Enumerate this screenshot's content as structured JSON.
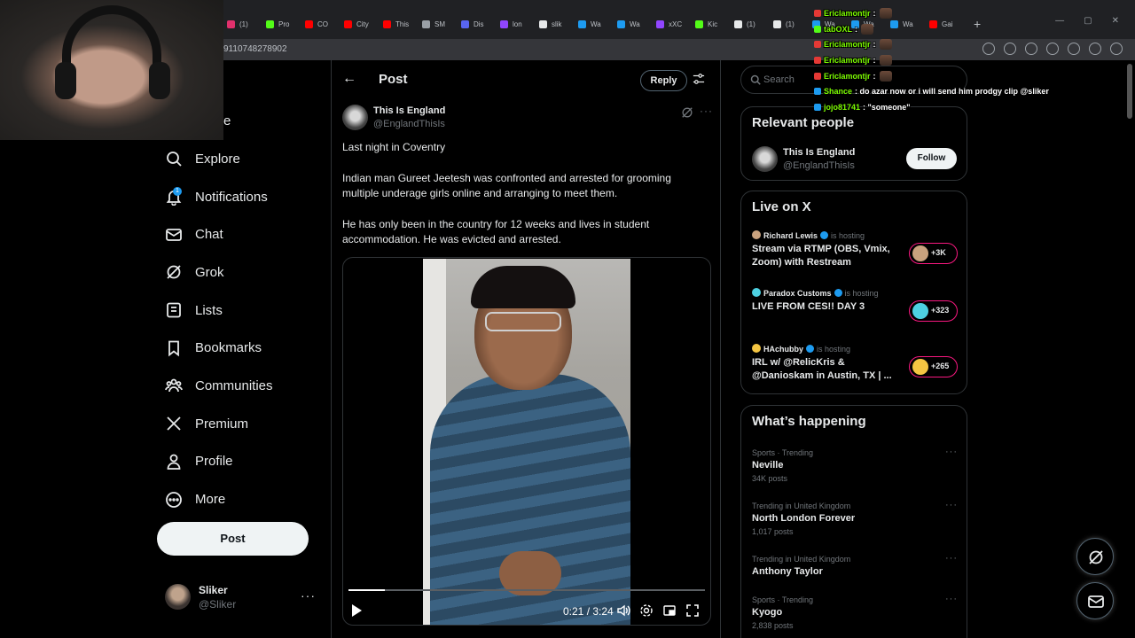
{
  "browser": {
    "tabs": [
      {
        "label": "(1)",
        "color": "#e1306c"
      },
      {
        "label": "Pro",
        "color": "#53fc18"
      },
      {
        "label": "CO",
        "color": "#ff0000"
      },
      {
        "label": "City",
        "color": "#ff0000"
      },
      {
        "label": "This",
        "color": "#ff0000"
      },
      {
        "label": "SM",
        "color": "#9aa0a6"
      },
      {
        "label": "Dis",
        "color": "#5865f2"
      },
      {
        "label": "lon",
        "color": "#9146ff"
      },
      {
        "label": "slik",
        "color": "#e7e9ea"
      },
      {
        "label": "Wa",
        "color": "#1d9bf0"
      },
      {
        "label": "Wa",
        "color": "#1d9bf0"
      },
      {
        "label": "xXC",
        "color": "#9146ff"
      },
      {
        "label": "Kic",
        "color": "#53fc18"
      },
      {
        "label": "(1)",
        "color": "#e7e9ea"
      },
      {
        "label": "(1)",
        "color": "#e7e9ea"
      },
      {
        "label": "Wa",
        "color": "#1d9bf0"
      },
      {
        "label": "Wa",
        "color": "#1d9bf0"
      },
      {
        "label": "Wa",
        "color": "#1d9bf0"
      },
      {
        "label": "Gai",
        "color": "#ff0000"
      }
    ],
    "new_tab": "+",
    "url_partial": "9110748278902"
  },
  "nav": {
    "partial_home": "e",
    "items": [
      {
        "label": "Explore",
        "icon": "search-icon"
      },
      {
        "label": "Notifications",
        "icon": "bell-icon",
        "badge": "1"
      },
      {
        "label": "Chat",
        "icon": "mail-icon"
      },
      {
        "label": "Grok",
        "icon": "grok-icon"
      },
      {
        "label": "Lists",
        "icon": "list-icon"
      },
      {
        "label": "Bookmarks",
        "icon": "bookmark-icon"
      },
      {
        "label": "Communities",
        "icon": "communities-icon"
      },
      {
        "label": "Premium",
        "icon": "x-logo-icon"
      },
      {
        "label": "Profile",
        "icon": "person-icon"
      },
      {
        "label": "More",
        "icon": "more-circle-icon"
      }
    ],
    "post_button": "Post",
    "account": {
      "name": "Sliker",
      "handle": "@Sliker"
    }
  },
  "main": {
    "header_title": "Post",
    "reply_button": "Reply",
    "author": {
      "name": "This Is England",
      "handle": "@EnglandThisIs"
    },
    "paragraphs": [
      "Last night in Coventry",
      "Indian man Gureet Jeetesh was confronted and arrested for grooming multiple underage girls online and arranging to meet them.",
      "He has only been in the country for 12 weeks and lives in student accommodation. He was evicted and arrested."
    ],
    "video": {
      "time": "0:21 / 3:24",
      "progress": 0.103
    }
  },
  "right": {
    "search_placeholder": "Search",
    "relevant": {
      "title": "Relevant people",
      "name": "This Is England",
      "handle": "@EnglandThisIs",
      "follow": "Follow"
    },
    "live": {
      "title": "Live on X",
      "items": [
        {
          "host": "Richard Lewis",
          "suffix": "is hosting",
          "title": "Stream via RTMP (OBS, Vmix, Zoom) with Restream",
          "count": "+3K",
          "color": "#c9a27e"
        },
        {
          "host": "Paradox Customs",
          "suffix": "is hosting",
          "title": "LIVE FROM CES!! DAY 3",
          "count": "+323",
          "color": "#4dd0e1"
        },
        {
          "host": "HAchubby",
          "suffix": "is hosting",
          "title": "IRL w/ @RelicKris & @Danioskam in Austin, TX | ...",
          "count": "+265",
          "color": "#f4c542"
        }
      ]
    },
    "happening": {
      "title": "What’s happening",
      "trends": [
        {
          "context": "Sports · Trending",
          "name": "Neville",
          "posts": "34K posts"
        },
        {
          "context": "Trending in United Kingdom",
          "name": "North London Forever",
          "posts": "1,017 posts"
        },
        {
          "context": "Trending in United Kingdom",
          "name": "Anthony Taylor",
          "posts": ""
        },
        {
          "context": "Sports · Trending",
          "name": "Kyogo",
          "posts": "2,838 posts"
        }
      ]
    }
  },
  "chat": [
    {
      "user": "Ericlamontjr",
      "msg": ":",
      "badge": "#e53935",
      "emote": true
    },
    {
      "user": "tabOXL",
      "msg": ":",
      "badge": "#53fc18",
      "emote": true
    },
    {
      "user": "Ericlamontjr",
      "msg": ":",
      "badge": "#e53935",
      "emote": true
    },
    {
      "user": "Ericlamontjr",
      "msg": ":",
      "badge": "#e53935",
      "emote": true
    },
    {
      "user": "Ericlamontjr",
      "msg": ":",
      "badge": "#e53935",
      "emote": true
    },
    {
      "user": "Shance",
      "msg": ": do azar now or i will send him prodgy clip @sliker",
      "badge": "#1d9bf0",
      "emote": false
    },
    {
      "user": "jojo81741",
      "msg": ": \"someone\"",
      "badge": "#1d9bf0",
      "emote": false
    }
  ]
}
